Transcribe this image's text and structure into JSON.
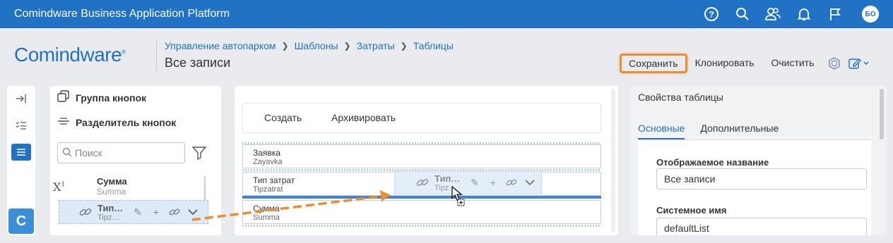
{
  "topbar": {
    "title": "Comindware Business Application Platform",
    "icons": [
      "help-icon",
      "search-icon",
      "users-icon",
      "bell-icon",
      "flag-icon"
    ],
    "avatar_initials": "БО"
  },
  "header": {
    "logo_text": "Comindware",
    "logo_mark": "®",
    "breadcrumb": [
      "Управление автопарком",
      "Шаблоны",
      "Затраты",
      "Таблицы"
    ],
    "page_title": "Все записи",
    "actions": {
      "save": "Сохранить",
      "clone": "Клонировать",
      "clear": "Очистить"
    }
  },
  "palette": {
    "button_group": "Группа кнопок",
    "button_separator": "Разделитель кнопок",
    "search_placeholder": "Поиск",
    "fields": [
      {
        "name": "Сумма",
        "system": "Summa"
      },
      {
        "name": "Тип…",
        "system": "Tipz…"
      }
    ]
  },
  "canvas": {
    "toolbar_buttons": [
      "Создать",
      "Архивировать"
    ],
    "columns": [
      {
        "name": "Заявка",
        "system": "Zayavka"
      },
      {
        "name": "Тип затрат",
        "system": "Tipzatrat"
      },
      {
        "name": "Сумма",
        "system": "Summa"
      }
    ],
    "ghost": {
      "name": "Тип…",
      "system": "Tipz…"
    }
  },
  "properties": {
    "title": "Свойства таблицы",
    "tabs": [
      "Основные",
      "Дополнительные"
    ],
    "display_name_label": "Отображаемое название",
    "display_name_value": "Все записи",
    "system_name_label": "Системное имя",
    "system_name_value": "defaultList"
  },
  "colors": {
    "brand": "#1f72c4",
    "highlight": "#f28c28"
  }
}
